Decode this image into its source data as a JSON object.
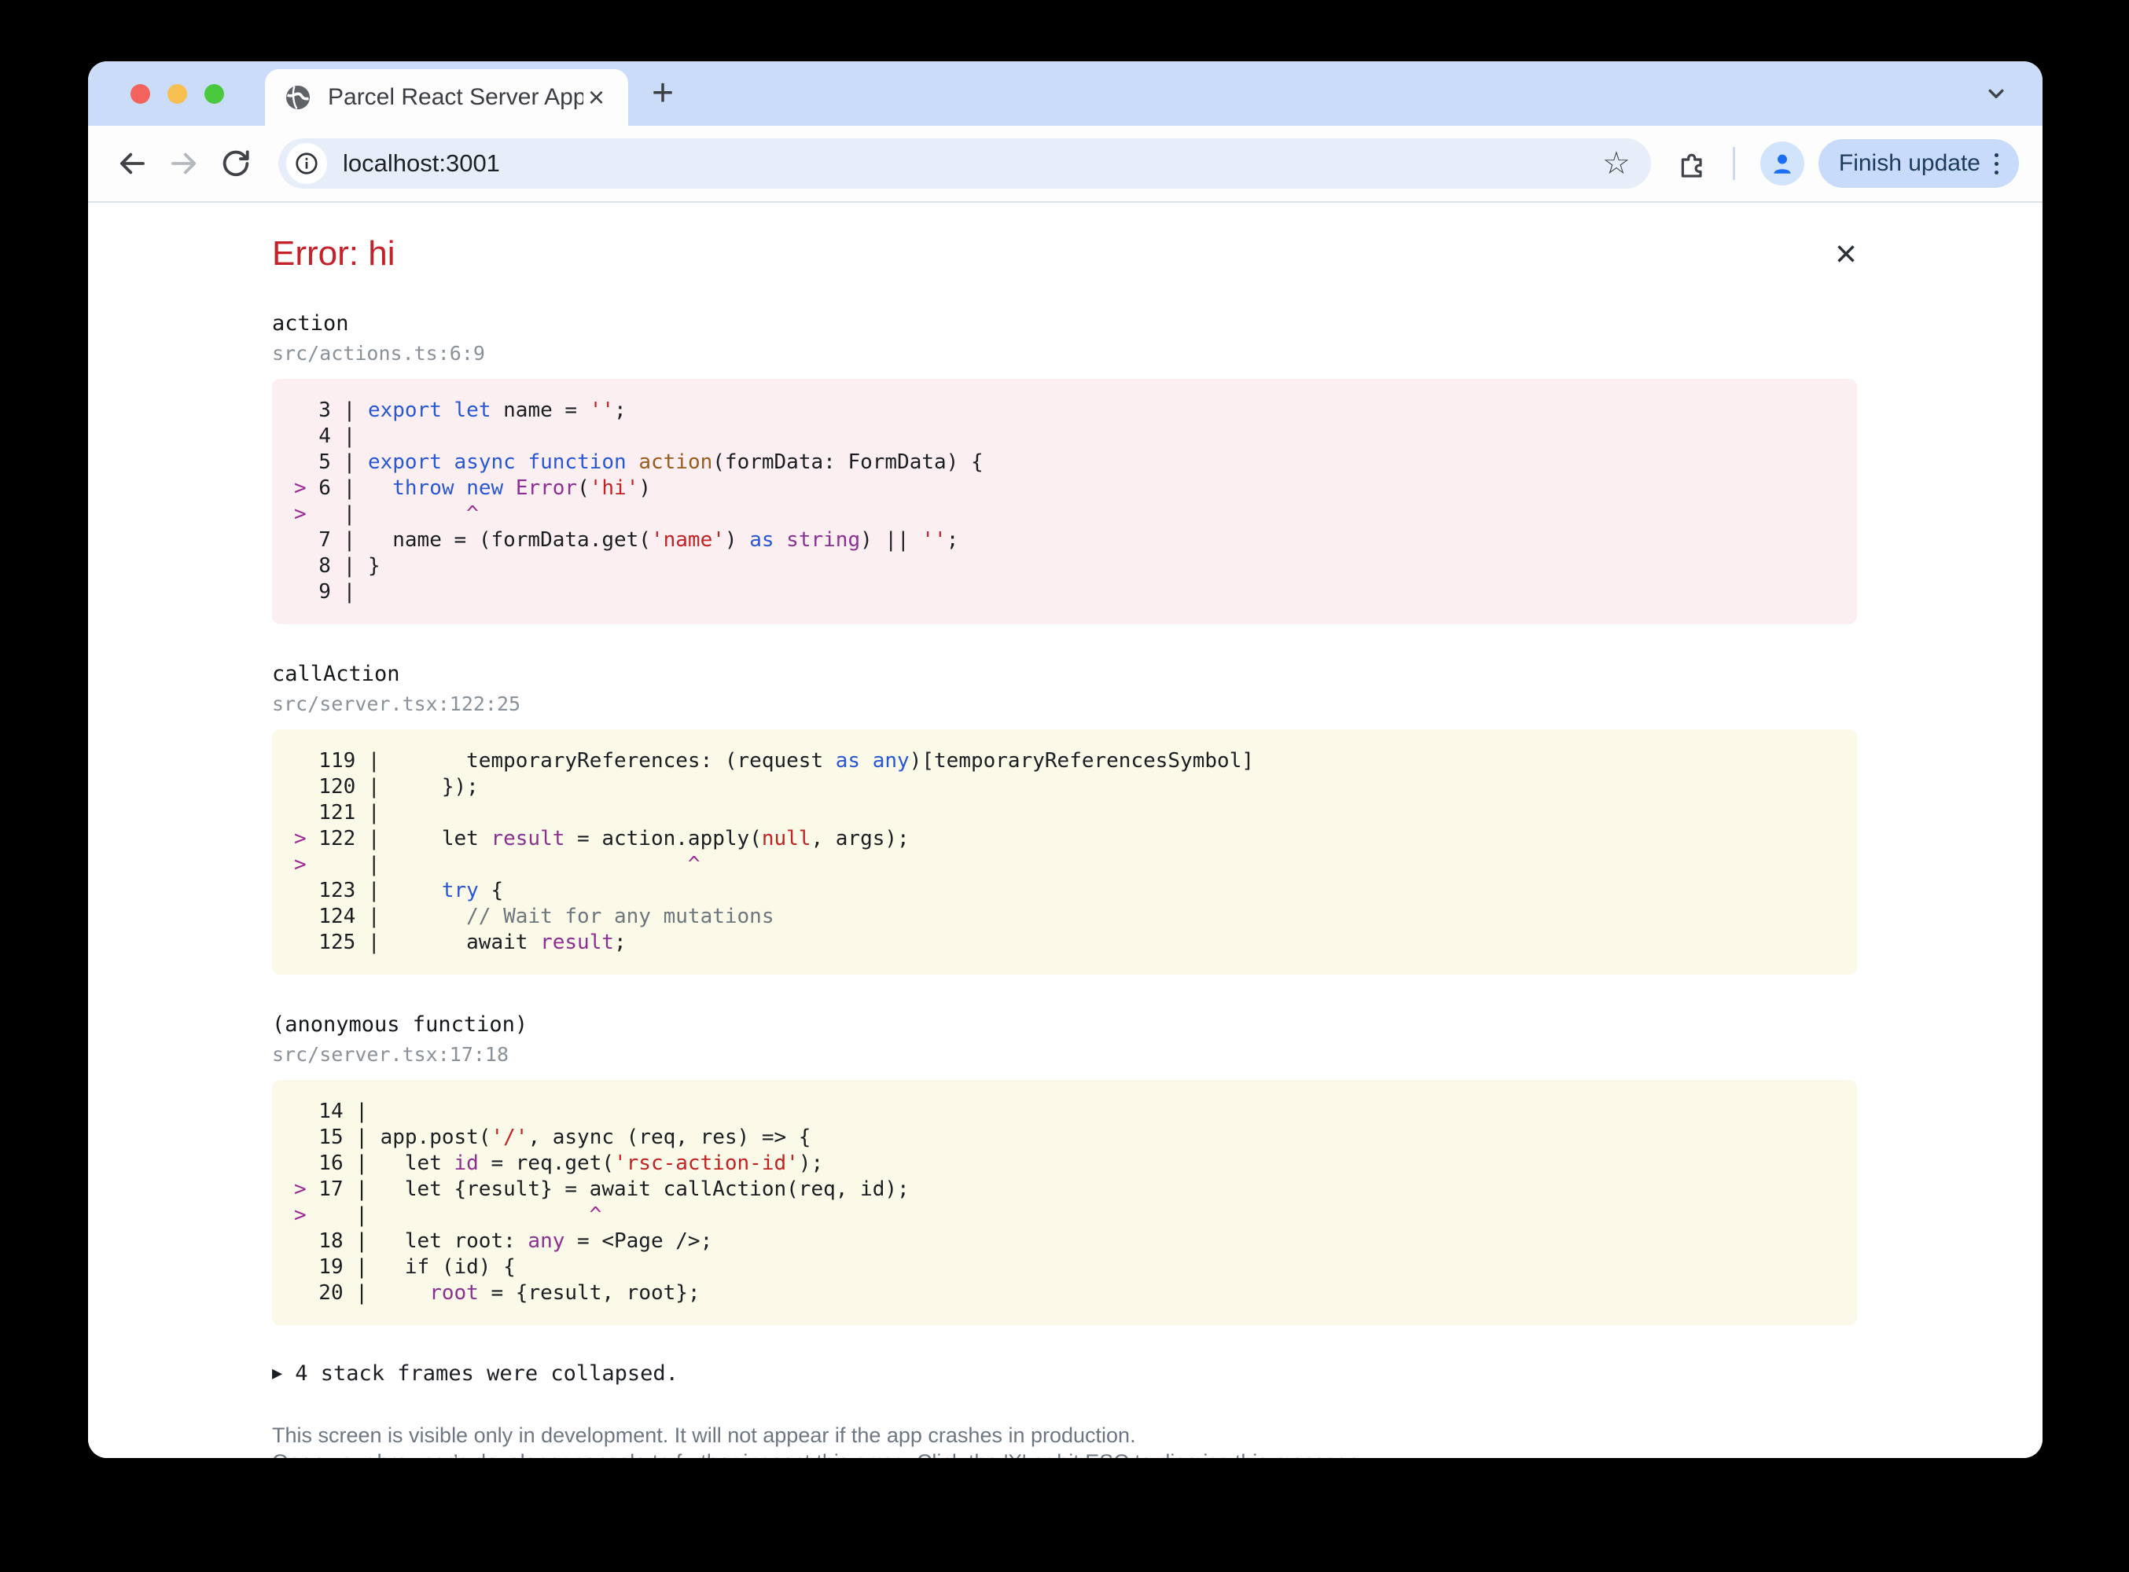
{
  "colors": {
    "error-title": "#c4212a",
    "frame-error-bg": "#fbeff1",
    "frame-warn-bg": "#fbf9e7",
    "tok-keyword": "#2857d6",
    "tok-type": "#8d2f92",
    "tok-string": "#c12223",
    "tok-func": "#9a5b1d",
    "tok-comment": "#6e777d",
    "tok-mark": "#9c2a94",
    "accent-blue": "#c9dbfa"
  },
  "chrome": {
    "traffic_lights": [
      "#f1635c",
      "#f6bf50",
      "#4ac93f"
    ],
    "tab": {
      "title": "Parcel React Server App",
      "close_glyph": "×",
      "new_tab_glyph": "+"
    },
    "toolbar": {
      "url": "localhost:3001",
      "star_glyph": "☆",
      "update_button": "Finish update"
    }
  },
  "overlay": {
    "title": "Error: hi",
    "close_glyph": "×",
    "frames": [
      {
        "name": "action",
        "location": "src/actions.ts:6:9",
        "variant": "error",
        "caret_col": 9,
        "lines": [
          {
            "num": "3",
            "tokens": [
              [
                "k",
                "export"
              ],
              [
                "p",
                " "
              ],
              [
                "k",
                "let"
              ],
              [
                "p",
                " name = "
              ],
              [
                "s",
                "''"
              ],
              [
                "p",
                ";"
              ]
            ]
          },
          {
            "num": "4",
            "tokens": []
          },
          {
            "num": "5",
            "tokens": [
              [
                "k",
                "export"
              ],
              [
                "p",
                " "
              ],
              [
                "k",
                "async"
              ],
              [
                "p",
                " "
              ],
              [
                "k",
                "function"
              ],
              [
                "p",
                " "
              ],
              [
                "f",
                "action"
              ],
              [
                "p",
                "(formData: FormData) {"
              ]
            ]
          },
          {
            "num": "6",
            "mark": true,
            "tokens": [
              [
                "p",
                "  "
              ],
              [
                "k",
                "throw"
              ],
              [
                "p",
                " "
              ],
              [
                "k",
                "new"
              ],
              [
                "p",
                " "
              ],
              [
                "t",
                "Error"
              ],
              [
                "p",
                "("
              ],
              [
                "s",
                "'hi'"
              ],
              [
                "p",
                ")"
              ]
            ]
          },
          {
            "caret": true
          },
          {
            "num": "7",
            "tokens": [
              [
                "p",
                "  name = (formData.get("
              ],
              [
                "s",
                "'name'"
              ],
              [
                "p",
                ") "
              ],
              [
                "k",
                "as"
              ],
              [
                "p",
                " "
              ],
              [
                "t",
                "string"
              ],
              [
                "p",
                ") || "
              ],
              [
                "s",
                "''"
              ],
              [
                "p",
                ";"
              ]
            ]
          },
          {
            "num": "8",
            "tokens": [
              [
                "p",
                "}"
              ]
            ]
          },
          {
            "num": "9",
            "tokens": []
          }
        ]
      },
      {
        "name": "callAction",
        "location": "src/server.tsx:122:25",
        "variant": "warn",
        "caret_col": 25,
        "lines": [
          {
            "num": "119",
            "tokens": [
              [
                "p",
                "      temporaryReferences: (request "
              ],
              [
                "k",
                "as"
              ],
              [
                "p",
                " "
              ],
              [
                "k",
                "any"
              ],
              [
                "p",
                ")[temporaryReferencesSymbol]"
              ]
            ]
          },
          {
            "num": "120",
            "tokens": [
              [
                "p",
                "    });"
              ]
            ]
          },
          {
            "num": "121",
            "tokens": []
          },
          {
            "num": "122",
            "mark": true,
            "tokens": [
              [
                "p",
                "    let "
              ],
              [
                "t",
                "result"
              ],
              [
                "p",
                " = action.apply("
              ],
              [
                "s",
                "null"
              ],
              [
                "p",
                ", args);"
              ]
            ]
          },
          {
            "caret": true
          },
          {
            "num": "123",
            "tokens": [
              [
                "p",
                "    "
              ],
              [
                "k",
                "try"
              ],
              [
                "p",
                " {"
              ]
            ]
          },
          {
            "num": "124",
            "tokens": [
              [
                "p",
                "      "
              ],
              [
                "c",
                "// Wait for any mutations"
              ]
            ]
          },
          {
            "num": "125",
            "tokens": [
              [
                "p",
                "      await "
              ],
              [
                "t",
                "result"
              ],
              [
                "p",
                ";"
              ]
            ]
          }
        ]
      },
      {
        "name": "(anonymous function)",
        "location": "src/server.tsx:17:18",
        "variant": "warn",
        "caret_col": 18,
        "lines": [
          {
            "num": "14",
            "tokens": []
          },
          {
            "num": "15",
            "tokens": [
              [
                "p",
                "app.post("
              ],
              [
                "s",
                "'/'"
              ],
              [
                "p",
                ", async (req, res) => {"
              ]
            ]
          },
          {
            "num": "16",
            "tokens": [
              [
                "p",
                "  let "
              ],
              [
                "t",
                "id"
              ],
              [
                "p",
                " = req.get("
              ],
              [
                "s",
                "'rsc-action-id'"
              ],
              [
                "p",
                ");"
              ]
            ]
          },
          {
            "num": "17",
            "mark": true,
            "tokens": [
              [
                "p",
                "  let {result} = await callAction(req, id);"
              ]
            ]
          },
          {
            "caret": true
          },
          {
            "num": "18",
            "tokens": [
              [
                "p",
                "  let root: "
              ],
              [
                "t",
                "any"
              ],
              [
                "p",
                " = <Page />;"
              ]
            ]
          },
          {
            "num": "19",
            "tokens": [
              [
                "p",
                "  if (id) {"
              ]
            ]
          },
          {
            "num": "20",
            "tokens": [
              [
                "p",
                "    "
              ],
              [
                "t",
                "root"
              ],
              [
                "p",
                " = {result, root};"
              ]
            ]
          }
        ]
      }
    ],
    "collapsed_marker": "▶",
    "collapsed_text": "4 stack frames were collapsed.",
    "footer_lines": [
      "This screen is visible only in development. It will not appear if the app crashes in production.",
      "Open your browser’s developer console to further inspect this error.  Click the 'X' or hit ESC to dismiss this message."
    ]
  }
}
